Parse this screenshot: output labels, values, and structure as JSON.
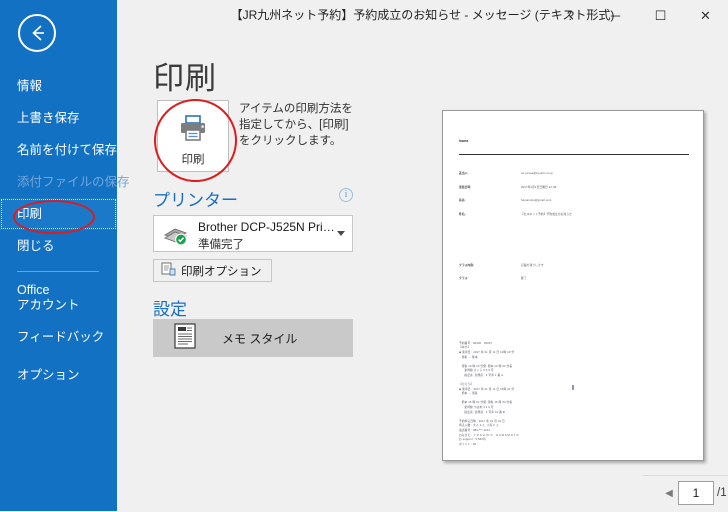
{
  "window": {
    "title": "【JR九州ネット予約】予約成立のお知らせ  -  メッセージ (テキスト形式)",
    "help_label": "?",
    "minimize_label": "─",
    "maximize_label": "☐",
    "close_label": "✕"
  },
  "sidebar": {
    "back_label": "back-arrow",
    "items": [
      {
        "label": "情報",
        "state": "normal"
      },
      {
        "label": "上書き保存",
        "state": "normal"
      },
      {
        "label": "名前を付けて保存",
        "state": "normal"
      },
      {
        "label": "添付ファイルの保存",
        "state": "disabled"
      },
      {
        "label": "印刷",
        "state": "selected"
      },
      {
        "label": "閉じる",
        "state": "normal"
      }
    ],
    "bottom_items": [
      {
        "line1": "Office",
        "line2": "アカウント"
      },
      {
        "line1": "フィードバック",
        "line2": ""
      },
      {
        "line1": "オプション",
        "line2": ""
      }
    ]
  },
  "print": {
    "heading": "印刷",
    "print_button_label": "印刷",
    "description": "アイテムの印刷方法を指定してから、[印刷] をクリックします。",
    "printer_section_title": "プリンター",
    "info_icon_label": "i",
    "printer_name": "Brother DCP-J525N Pri…",
    "printer_status": "準備完了",
    "print_options_label": "印刷オプション",
    "settings_section_title": "設定",
    "style_label": "メモ スタイル"
  },
  "preview": {
    "page_number": "1",
    "page_total": "/1",
    "prev_arrow": "◀",
    "next_arrow": "▶",
    "view_icons": [
      "actual-size-icon",
      "fit-to-page-icon",
      "multiple-pages-icon"
    ],
    "document": {
      "header": "hama",
      "fields": [
        {
          "key": "差出人:",
          "value": "ne.yoana@kyuuhn.co.jp"
        },
        {
          "key": "送信日時:",
          "value": "2017年1月1日日曜日 22:48"
        },
        {
          "key": "宛先:",
          "value": "hamamoto@gmail.com"
        },
        {
          "key": "件名:",
          "value": "【九州ネット予約】予約成立のお知らせ"
        }
      ],
      "fields2": [
        {
          "key": "クラス内容:",
          "value": "記載の通りします"
        },
        {
          "key": "クラス:",
          "value": "確了"
        }
      ],
      "body": [
        "予約番号 : 00000   00007",
        "【ゆき】",
        "◆ 乗車日 : 2017 年 01 月 11 日 10時 20 分",
        "   博多 → 熊本",
        "",
        "   博多 10 時 20 分発  熊本 10 時 52 分着",
        "      新幹線 さくら 6 0 3 号",
        "      指定席  禁煙席   4 号車 1 番 A",
        "",
        "【かえり】",
        "◆ 乗車日 : 2017 年 01 月 11 日 15時 01 分",
        "   熊本 → 博多",
        "",
        "   熊本 15 時 01 分発  博多 15 時 33 分着",
        "      新幹線 つばめ 3 3 0 号",
        "      指定席  禁煙席   4 号車 10 番 B",
        "",
        "予約申込日時 : 2017 年 01 月 01 日",
        "申込人数 : 大人 1 人  小児 0 人",
        "電話番号 : 080-***-1101",
        "おなまえ :  Y O S H I K O    H A M A M O T O",
        "お support : 5,560円",
        "ポイント : 50"
      ]
    }
  },
  "colors": {
    "sidebar_blue": "#1271c3",
    "accent_blue": "#1a6fc4",
    "annotation_red": "#e01b1b",
    "page_bg": "#f0f0f0"
  }
}
